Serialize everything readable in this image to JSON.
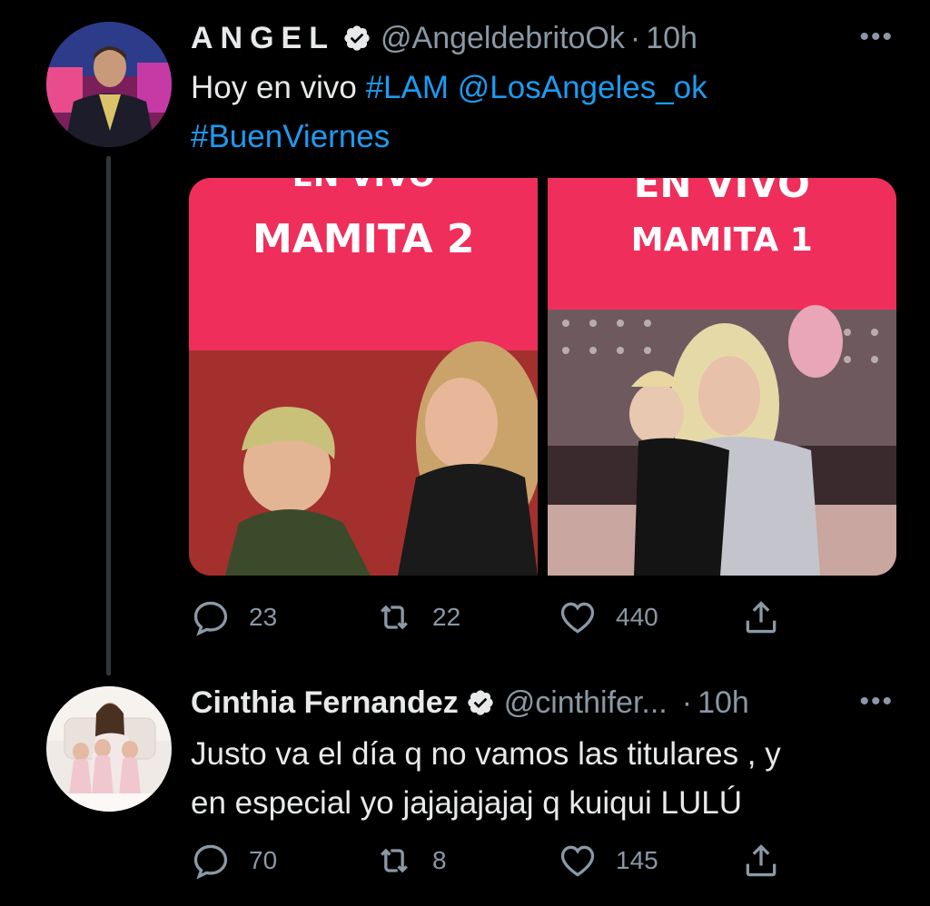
{
  "tweet1": {
    "display_name": "ANGEL",
    "handle": "@AngeldebritoOk",
    "time_sep": "·",
    "time": "10h",
    "more": "•••",
    "text_plain": "Hoy en vivo ",
    "hashtag1": "#LAM",
    "mention": "@LosAngeles_ok",
    "hashtag2": "#BuenViernes",
    "media": [
      {
        "top_text": "EN VIVO",
        "title": "MAMITA 2"
      },
      {
        "top_text": "EN VIVO",
        "title": "MAMITA 1"
      }
    ],
    "replies": "23",
    "retweets": "22",
    "likes": "440"
  },
  "tweet2": {
    "display_name": "Cinthia Fernandez",
    "handle": "@cinthifer...",
    "time_sep": "·",
    "time": "10h",
    "more": "•••",
    "text_line1": "Justo va el día q no vamos las titulares , y",
    "text_line2": "en especial yo jajajajajaj q kuiqui LULÚ",
    "replies": "70",
    "retweets": "8",
    "likes": "145"
  },
  "colors": {
    "background": "#000000",
    "link": "#1d9bf0",
    "secondary": "#8b98a5",
    "banner": "#ef2e5b"
  },
  "icons": [
    "verified-badge-icon",
    "more-icon",
    "reply-icon",
    "retweet-icon",
    "like-icon",
    "share-icon"
  ]
}
